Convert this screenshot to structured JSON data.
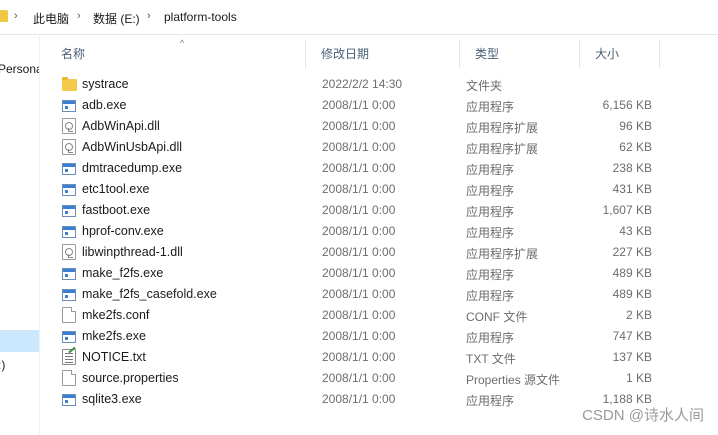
{
  "breadcrumb": {
    "items": [
      "此电脑",
      "数据 (E:)",
      "platform-tools"
    ],
    "separator": "›"
  },
  "nav": {
    "partial_labels": [
      "Persona",
      ":)"
    ]
  },
  "columns": {
    "name": "名称",
    "date": "修改日期",
    "type": "类型",
    "size": "大小"
  },
  "files": [
    {
      "name": "systrace",
      "date": "2022/2/2 14:30",
      "type": "文件夹",
      "size": "",
      "icon": "folder-icon"
    },
    {
      "name": "adb.exe",
      "date": "2008/1/1 0:00",
      "type": "应用程序",
      "size": "6,156 KB",
      "icon": "exe-icon"
    },
    {
      "name": "AdbWinApi.dll",
      "date": "2008/1/1 0:00",
      "type": "应用程序扩展",
      "size": "96 KB",
      "icon": "dll-icon"
    },
    {
      "name": "AdbWinUsbApi.dll",
      "date": "2008/1/1 0:00",
      "type": "应用程序扩展",
      "size": "62 KB",
      "icon": "dll-icon"
    },
    {
      "name": "dmtracedump.exe",
      "date": "2008/1/1 0:00",
      "type": "应用程序",
      "size": "238 KB",
      "icon": "exe-icon"
    },
    {
      "name": "etc1tool.exe",
      "date": "2008/1/1 0:00",
      "type": "应用程序",
      "size": "431 KB",
      "icon": "exe-icon"
    },
    {
      "name": "fastboot.exe",
      "date": "2008/1/1 0:00",
      "type": "应用程序",
      "size": "1,607 KB",
      "icon": "exe-icon"
    },
    {
      "name": "hprof-conv.exe",
      "date": "2008/1/1 0:00",
      "type": "应用程序",
      "size": "43 KB",
      "icon": "exe-icon"
    },
    {
      "name": "libwinpthread-1.dll",
      "date": "2008/1/1 0:00",
      "type": "应用程序扩展",
      "size": "227 KB",
      "icon": "dll-icon"
    },
    {
      "name": "make_f2fs.exe",
      "date": "2008/1/1 0:00",
      "type": "应用程序",
      "size": "489 KB",
      "icon": "exe-icon"
    },
    {
      "name": "make_f2fs_casefold.exe",
      "date": "2008/1/1 0:00",
      "type": "应用程序",
      "size": "489 KB",
      "icon": "exe-icon"
    },
    {
      "name": "mke2fs.conf",
      "date": "2008/1/1 0:00",
      "type": "CONF 文件",
      "size": "2 KB",
      "icon": "document-icon"
    },
    {
      "name": "mke2fs.exe",
      "date": "2008/1/1 0:00",
      "type": "应用程序",
      "size": "747 KB",
      "icon": "exe-icon"
    },
    {
      "name": "NOTICE.txt",
      "date": "2008/1/1 0:00",
      "type": "TXT 文件",
      "size": "137 KB",
      "icon": "text-file-icon"
    },
    {
      "name": "source.properties",
      "date": "2008/1/1 0:00",
      "type": "Properties 源文件",
      "size": "1 KB",
      "icon": "document-icon"
    },
    {
      "name": "sqlite3.exe",
      "date": "2008/1/1 0:00",
      "type": "应用程序",
      "size": "1,188 KB",
      "icon": "exe-icon"
    }
  ],
  "watermark": "CSDN @诗水人间"
}
